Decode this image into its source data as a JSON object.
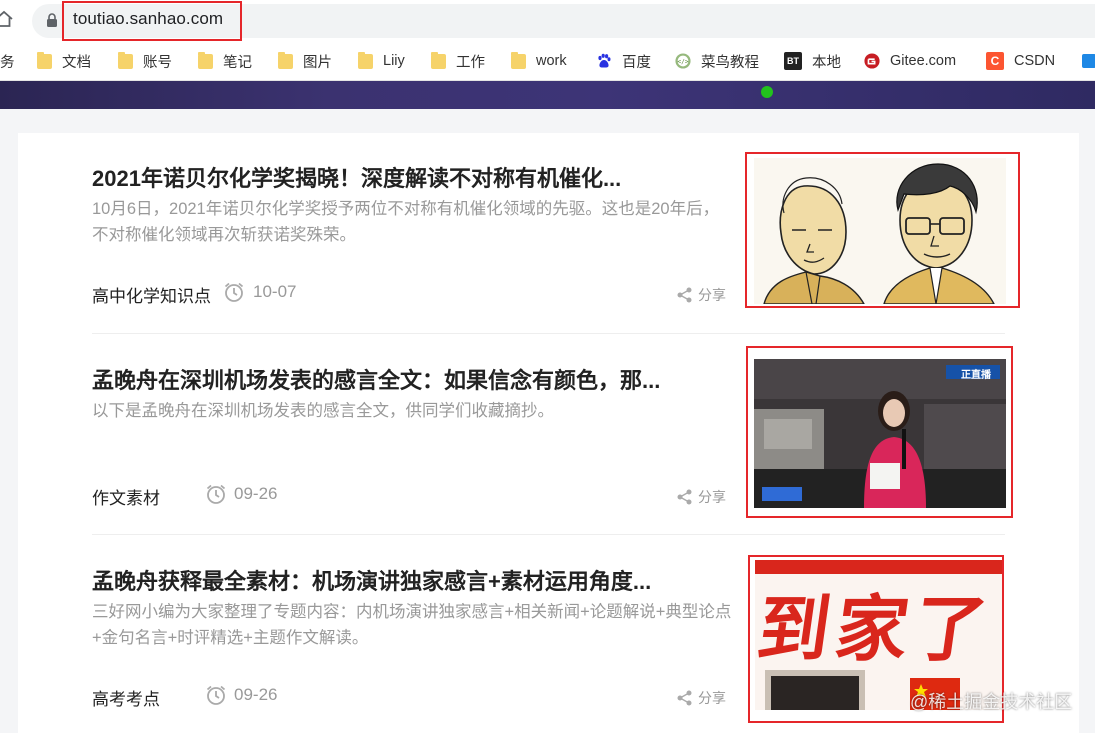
{
  "browser": {
    "url": "toutiao.sanhao.com",
    "bookmarks": [
      {
        "label": "务",
        "icon": "none"
      },
      {
        "label": "文档",
        "icon": "folder-icon"
      },
      {
        "label": "账号",
        "icon": "folder-icon"
      },
      {
        "label": "笔记",
        "icon": "folder-icon"
      },
      {
        "label": "图片",
        "icon": "folder-icon"
      },
      {
        "label": "Liiy",
        "icon": "folder-icon"
      },
      {
        "label": "工作",
        "icon": "folder-icon"
      },
      {
        "label": "work",
        "icon": "folder-icon"
      },
      {
        "label": "百度",
        "icon": "baidu-paw-icon"
      },
      {
        "label": "菜鸟教程",
        "icon": "runoob-icon"
      },
      {
        "label": "本地",
        "icon": "bt-icon"
      },
      {
        "label": "Gitee.com",
        "icon": "gitee-icon"
      },
      {
        "label": "CSDN",
        "icon": "csdn-icon"
      }
    ],
    "bt_text": "BT",
    "csdn_letter": "C"
  },
  "articles": [
    {
      "title": "2021年诺贝尔化学奖揭晓！深度解读不对称有机催化...",
      "abstract": "10月6日，2021年诺贝尔化学奖授予两位不对称有机催化领域的先驱。这也是20年后，不对称催化领域再次斩获诺奖殊荣。",
      "source": "高中化学知识点",
      "date": "10-07",
      "share": "分享"
    },
    {
      "title": "孟晚舟在深圳机场发表的感言全文：如果信念有颜色，那...",
      "abstract": "以下是孟晚舟在深圳机场发表的感言全文，供同学们收藏摘抄。",
      "source": "作文素材",
      "date": "09-26",
      "share": "分享",
      "image_caption": "正直播"
    },
    {
      "title": "孟晚舟获释最全素材：机场演讲独家感言+素材运用角度...",
      "abstract": "三好网小编为大家整理了专题内容：内机场演讲独家感言+相关新闻+论题解说+典型论点+金句名言+时评精选+主题作文解读。",
      "source": "高考考点",
      "date": "09-26",
      "share": "分享",
      "image_caption": "到家了"
    }
  ],
  "watermark": "@稀土掘金技术社区",
  "colors": {
    "annotation_red": "#e5262a",
    "banner": "#3b3270",
    "status_dot": "#22c21d",
    "muted_text": "#999999"
  }
}
